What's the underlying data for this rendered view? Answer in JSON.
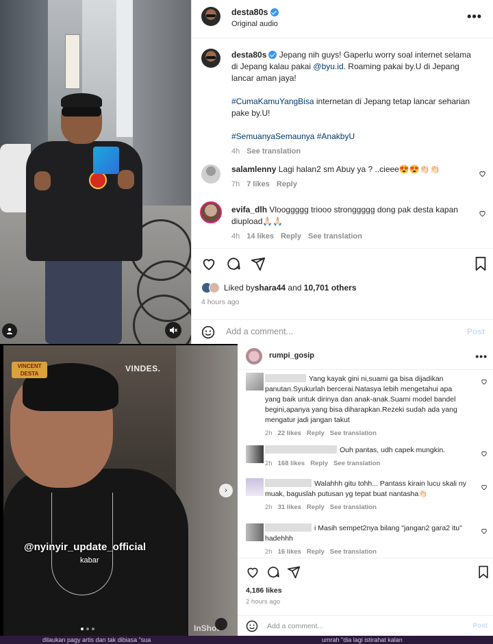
{
  "top_post": {
    "header": {
      "username": "desta80s",
      "subtitle": "Original audio",
      "more": "•••"
    },
    "caption": {
      "username": "desta80s",
      "line1a": "Jepang nih guys! Gaperlu worry soal internet selama",
      "line2a": "di Jepang kalau pakai ",
      "mention": "@byu.id",
      "line2b": ". Roaming pakai by.U di Jepang",
      "line3": "lancar aman jaya!",
      "hashtag1": "#CumaKamuYangBisa",
      "line4b": " internetan di Jepang tetap lancar seharian",
      "line5": "pake by.U!",
      "hashtags2": "#SemuanyaSemaunya #AnakbyU",
      "time": "4h",
      "see_translation": "See translation"
    },
    "comments": [
      {
        "username": "salamlenny",
        "text": "Lagi halan2 sm Abuy ya ? ..cieee😍😍👏🏻👏🏻",
        "time": "7h",
        "likes": "7 likes",
        "reply": "Reply"
      },
      {
        "username": "evifa_dlh",
        "text": "Vlooggggg triooo stronggggg dong pak desta kapan",
        "text2": "diupload🙏🏻🙏🏻",
        "time": "4h",
        "likes": "14 likes",
        "reply": "Reply",
        "see_translation": "See translation"
      }
    ],
    "liked_by_prefix": "Liked by ",
    "liked_by_user": "shara44",
    "liked_by_and": " and ",
    "liked_by_others": "10,701 others",
    "posted_ago": "4 hours ago",
    "add_comment_placeholder": "Add a comment...",
    "post_label": "Post"
  },
  "bottom_post": {
    "header": {
      "username": "rumpi_gosip",
      "more": "•••"
    },
    "video": {
      "vb_logo": "VINCENT DESTA",
      "vindes_mark": "VINDES.",
      "watermark": "@nyinyir_update_official",
      "subtitle": "kabar",
      "inshot": "InShot"
    },
    "comments": [
      {
        "l1": "Yang kayak gini ni,suami ga bisa dijadikan",
        "l2": "panutan.Syukurlah bercerai.Natasya lebih mengetahui apa",
        "l3": "yang baik untuk dirinya dan anak-anak.Suami model bandel",
        "l4": "begini,apanya yang bisa diharapkan.Rezeki sudah ada yang",
        "l5": "mengatur jadi jangan takut",
        "time": "2h",
        "likes": "22 likes",
        "reply": "Reply",
        "see_translation": "See translation"
      },
      {
        "l1": "Ouh pantas, udh capek mungkin.",
        "time": "2h",
        "likes": "168 likes",
        "reply": "Reply",
        "see_translation": "See translation"
      },
      {
        "l1": "Walahhh gitu tohh... Pantass kirain lucu skali ny",
        "l2": "muak, baguslah putusan yg tepat buat nantasha👏🏻",
        "time": "2h",
        "likes": "31 likes",
        "reply": "Reply",
        "see_translation": "See translation"
      },
      {
        "l1": "i Masih sempet2nya bilang \"jangan2 gara2 itu\"",
        "l2": "hadehhh",
        "time": "2h",
        "likes": "16 likes",
        "reply": "Reply",
        "see_translation": "See translation"
      }
    ],
    "likes": "4,186 likes",
    "posted_ago": "2 hours ago",
    "add_comment_placeholder": "Add a comment...",
    "post_label": "Post"
  },
  "bottom_strip": {
    "left": "dilaukan pagy artis dan tak dibiasa \"sua",
    "right": "umrah \"dia lagi istirahat kalan"
  },
  "colors": {
    "link": "#00376b",
    "verified": "#3897f0",
    "meta": "#8e8e8e",
    "post_disabled": "#c7def8"
  }
}
